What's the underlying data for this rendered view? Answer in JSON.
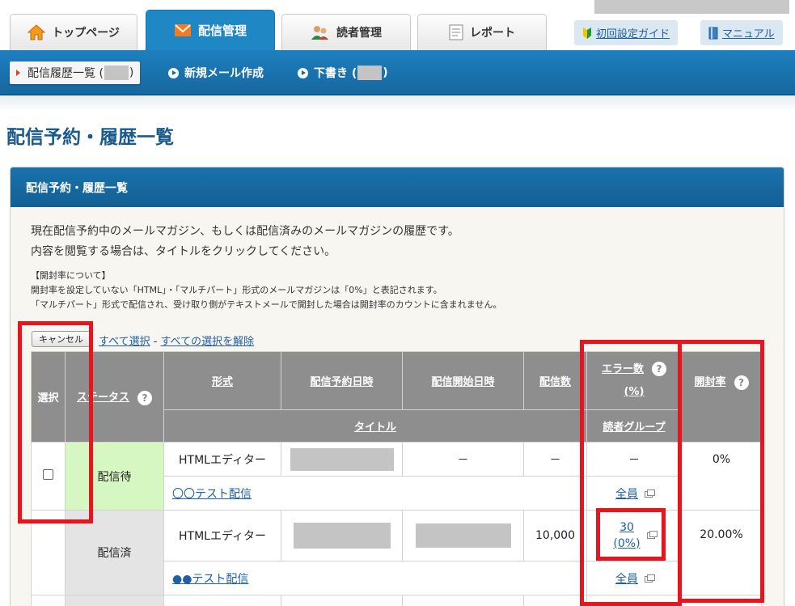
{
  "tabs": [
    {
      "label": "トップページ",
      "icon": "home-icon"
    },
    {
      "label": "配信管理",
      "icon": "mail-icon"
    },
    {
      "label": "読者管理",
      "icon": "users-icon"
    },
    {
      "label": "レポート",
      "icon": "report-icon"
    }
  ],
  "links": {
    "guide": "初回設定ガイド",
    "manual": "マニュアル"
  },
  "subnav": {
    "history_prefix": "配信履歴一覧 (",
    "history_suffix": ")",
    "new_mail": "新規メール作成",
    "draft_prefix": "下書き (",
    "draft_suffix": ")"
  },
  "page_title": "配信予約・履歴一覧",
  "panel": {
    "header": "配信予約・履歴一覧",
    "desc1": "現在配信予約中のメールマガジン、もしくは配信済みのメールマガジンの履歴です。",
    "desc2": "内容を閲覧する場合は、タイトルをクリックしてください。",
    "note_title": "【開封率について】",
    "note1": "開封率を設定していない「HTML」・「マルチパート」形式のメールマガジンは「0%」と表記されます。",
    "note2": "「マルチパート」形式で配信され、受け取り側がテキストメールで開封した場合は開封率のカウントに含まれません。"
  },
  "controls": {
    "cancel": "キャンセル",
    "select_all": "すべて選択",
    "sep": " - ",
    "deselect_all": "すべての選択を解除"
  },
  "table": {
    "headers": {
      "select": "選択",
      "status": "ステータス",
      "format": "形式",
      "scheduled": "配信予約日時",
      "started": "配信開始日時",
      "count": "配信数",
      "errors": "エラー数",
      "errors_pct": "(%)",
      "open_rate": "開封率",
      "title": "タイトル",
      "group": "読者グループ",
      "help": "?"
    },
    "rows": [
      {
        "status": "配信待",
        "format": "HTMLエディター",
        "started": "－",
        "count": "－",
        "errors": "－",
        "open_rate": "0%",
        "title": "〇〇テスト配信",
        "group": "全員"
      },
      {
        "status": "配信済",
        "format": "HTMLエディター",
        "count": "10,000",
        "errors_num": "30",
        "errors_pct": "(0%)",
        "open_rate": "20.00%",
        "title": "●●テスト配信",
        "group": "全員"
      }
    ]
  }
}
